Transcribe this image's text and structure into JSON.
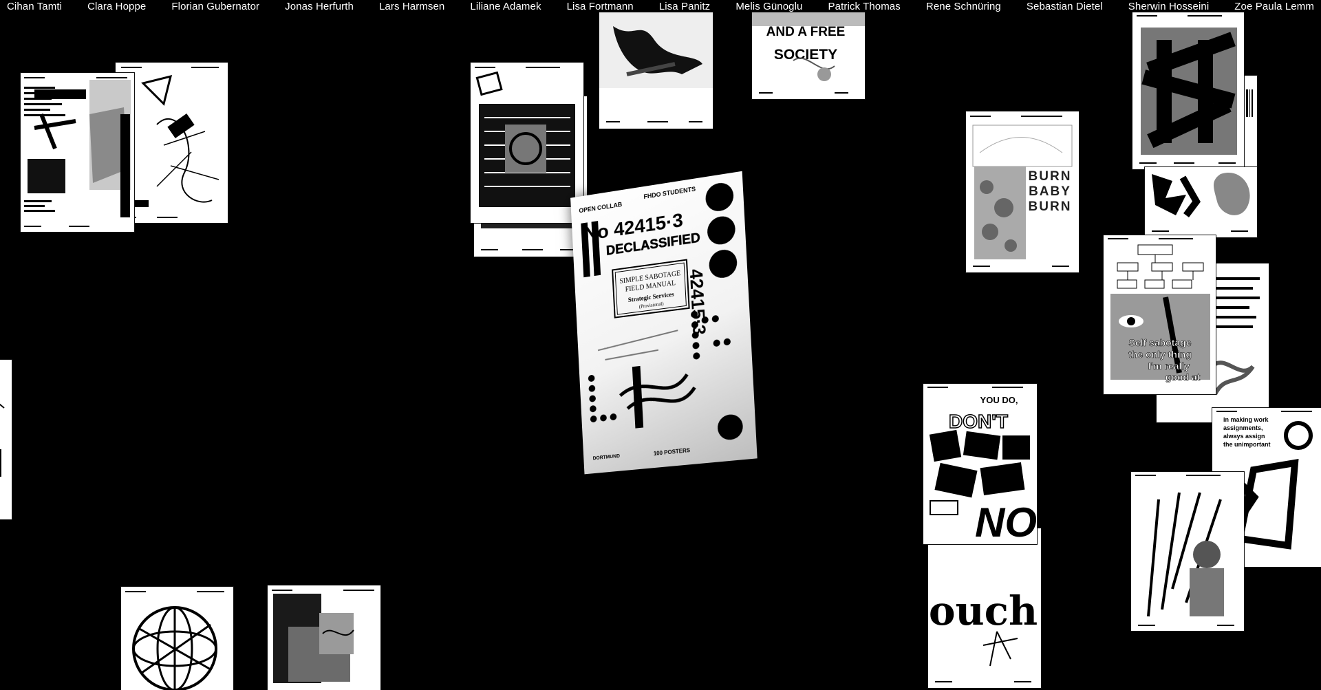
{
  "nav": {
    "names": [
      "Cihan Tamti",
      "Clara Hoppe",
      "Florian Gubernator",
      "Jonas Herfurth",
      "Lars Harmsen",
      "Liliane Adamek",
      "Lisa Fortmann",
      "Lisa Panitz",
      "Melis Günoglu",
      "Patrick Thomas",
      "Rene Schnüring",
      "Sebastian Dietel",
      "Sherwin Hosseini",
      "Zoe Paula Lemm"
    ]
  },
  "posters": {
    "main": {
      "header_left": "OPEN COLLAB",
      "header_right": "FHDO STUDENTS",
      "number": "No 42415·3",
      "word": "DECLASSIFIED",
      "box_line1": "SIMPLE SABOTAGE",
      "box_line2": "FIELD MANUAL",
      "box_line3": "Strategic Services",
      "box_line4": "(Provisional)",
      "vertical_number": "42415·3",
      "footer_left": "DORTMUND",
      "footer_right": "100 POSTERS"
    },
    "free_society": {
      "line1": "AND A FREE",
      "line2": "SOCIETY"
    },
    "burn": {
      "line1": "BURN",
      "line2": "BABY",
      "line3": "BURN"
    },
    "sabotage": {
      "line1": "Self sabotage",
      "line2": "the only thing",
      "line3": "I'm really",
      "line4": "good at"
    },
    "ouch": {
      "word": "ouch"
    },
    "dont": {
      "line1": "YOU DO,",
      "line2": "DON'T",
      "line3": "NO"
    },
    "making_work": {
      "line1": "in making work",
      "line2": "assignments,",
      "line3": "always assign",
      "line4": "the unimportant"
    }
  }
}
